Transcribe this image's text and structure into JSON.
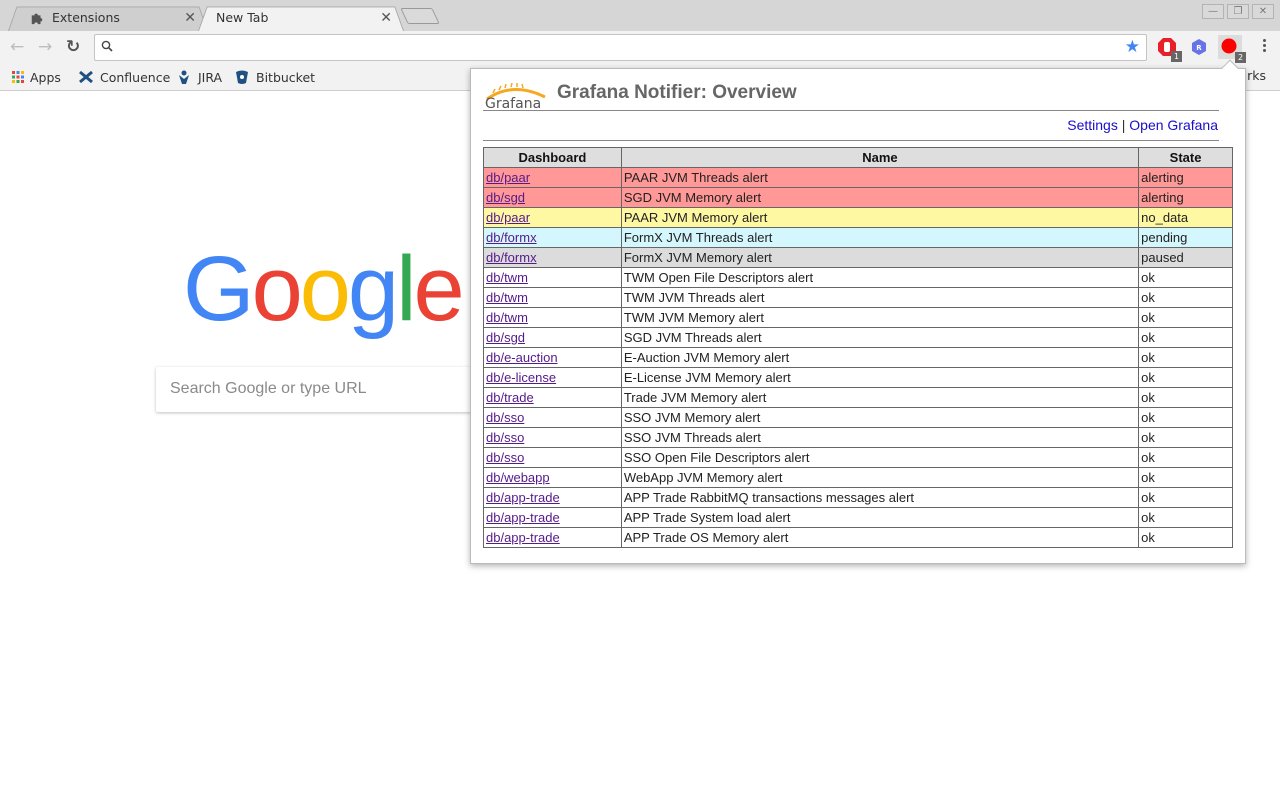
{
  "browser": {
    "tabs": [
      {
        "label": "Extensions",
        "icon": "puzzle-icon",
        "active": false
      },
      {
        "label": "New Tab",
        "icon": "",
        "active": true
      }
    ],
    "omnibox": {
      "value": "",
      "placeholder": ""
    },
    "bookmarks": [
      {
        "label": "Apps",
        "icon": "apps-grid-icon"
      },
      {
        "label": "Confluence",
        "icon": "confluence-icon"
      },
      {
        "label": "JIRA",
        "icon": "jira-icon"
      },
      {
        "label": "Bitbucket",
        "icon": "bitbucket-icon"
      }
    ],
    "bookmarks_overflow_label": "arks",
    "extensions": [
      {
        "name": "adblock-extension",
        "badge": "1",
        "color": "#e8202a"
      },
      {
        "name": "r-extension",
        "badge": "",
        "color": "#6674e8"
      },
      {
        "name": "grafana-notifier-extension",
        "badge": "2",
        "color": "#ff0000"
      }
    ]
  },
  "ntp": {
    "logo_letters": [
      {
        "ch": "G",
        "color": "#4285f4"
      },
      {
        "ch": "o",
        "color": "#ea4335"
      },
      {
        "ch": "o",
        "color": "#fbbc05"
      },
      {
        "ch": "g",
        "color": "#4285f4"
      },
      {
        "ch": "l",
        "color": "#34a853"
      },
      {
        "ch": "e",
        "color": "#ea4335"
      }
    ],
    "search_placeholder": "Search Google or type URL"
  },
  "popup": {
    "logo_text": "Grafana",
    "title": "Grafana Notifier: Overview",
    "links": {
      "settings": "Settings",
      "separator": "|",
      "open_grafana": "Open Grafana"
    },
    "table": {
      "headers": [
        "Dashboard",
        "Name",
        "State"
      ],
      "rows": [
        {
          "dashboard": "db/paar",
          "name": "PAAR JVM Threads alert",
          "state": "alerting"
        },
        {
          "dashboard": "db/sgd",
          "name": "SGD JVM Memory alert",
          "state": "alerting"
        },
        {
          "dashboard": "db/paar",
          "name": "PAAR JVM Memory alert",
          "state": "no_data"
        },
        {
          "dashboard": "db/formx",
          "name": "FormX JVM Threads alert",
          "state": "pending"
        },
        {
          "dashboard": "db/formx",
          "name": "FormX JVM Memory alert",
          "state": "paused"
        },
        {
          "dashboard": "db/twm",
          "name": "TWM Open File Descriptors alert",
          "state": "ok"
        },
        {
          "dashboard": "db/twm",
          "name": "TWM JVM Threads alert",
          "state": "ok"
        },
        {
          "dashboard": "db/twm",
          "name": "TWM JVM Memory alert",
          "state": "ok"
        },
        {
          "dashboard": "db/sgd",
          "name": "SGD JVM Threads alert",
          "state": "ok"
        },
        {
          "dashboard": "db/e-auction",
          "name": "E-Auction JVM Memory alert",
          "state": "ok"
        },
        {
          "dashboard": "db/e-license",
          "name": "E-License JVM Memory alert",
          "state": "ok"
        },
        {
          "dashboard": "db/trade",
          "name": "Trade JVM Memory alert",
          "state": "ok"
        },
        {
          "dashboard": "db/sso",
          "name": "SSO JVM Memory alert",
          "state": "ok"
        },
        {
          "dashboard": "db/sso",
          "name": "SSO JVM Threads alert",
          "state": "ok"
        },
        {
          "dashboard": "db/sso",
          "name": "SSO Open File Descriptors alert",
          "state": "ok"
        },
        {
          "dashboard": "db/webapp",
          "name": "WebApp JVM Memory alert",
          "state": "ok"
        },
        {
          "dashboard": "db/app-trade",
          "name": "APP Trade RabbitMQ transactions messages alert",
          "state": "ok"
        },
        {
          "dashboard": "db/app-trade",
          "name": "APP Trade System load alert",
          "state": "ok"
        },
        {
          "dashboard": "db/app-trade",
          "name": "APP Trade OS Memory alert",
          "state": "ok"
        }
      ]
    },
    "state_colors": {
      "alerting": "#ff9896",
      "no_data": "#fff8a3",
      "pending": "#d4f6fd",
      "paused": "#dcdcdc",
      "ok": "#ffffff"
    }
  }
}
